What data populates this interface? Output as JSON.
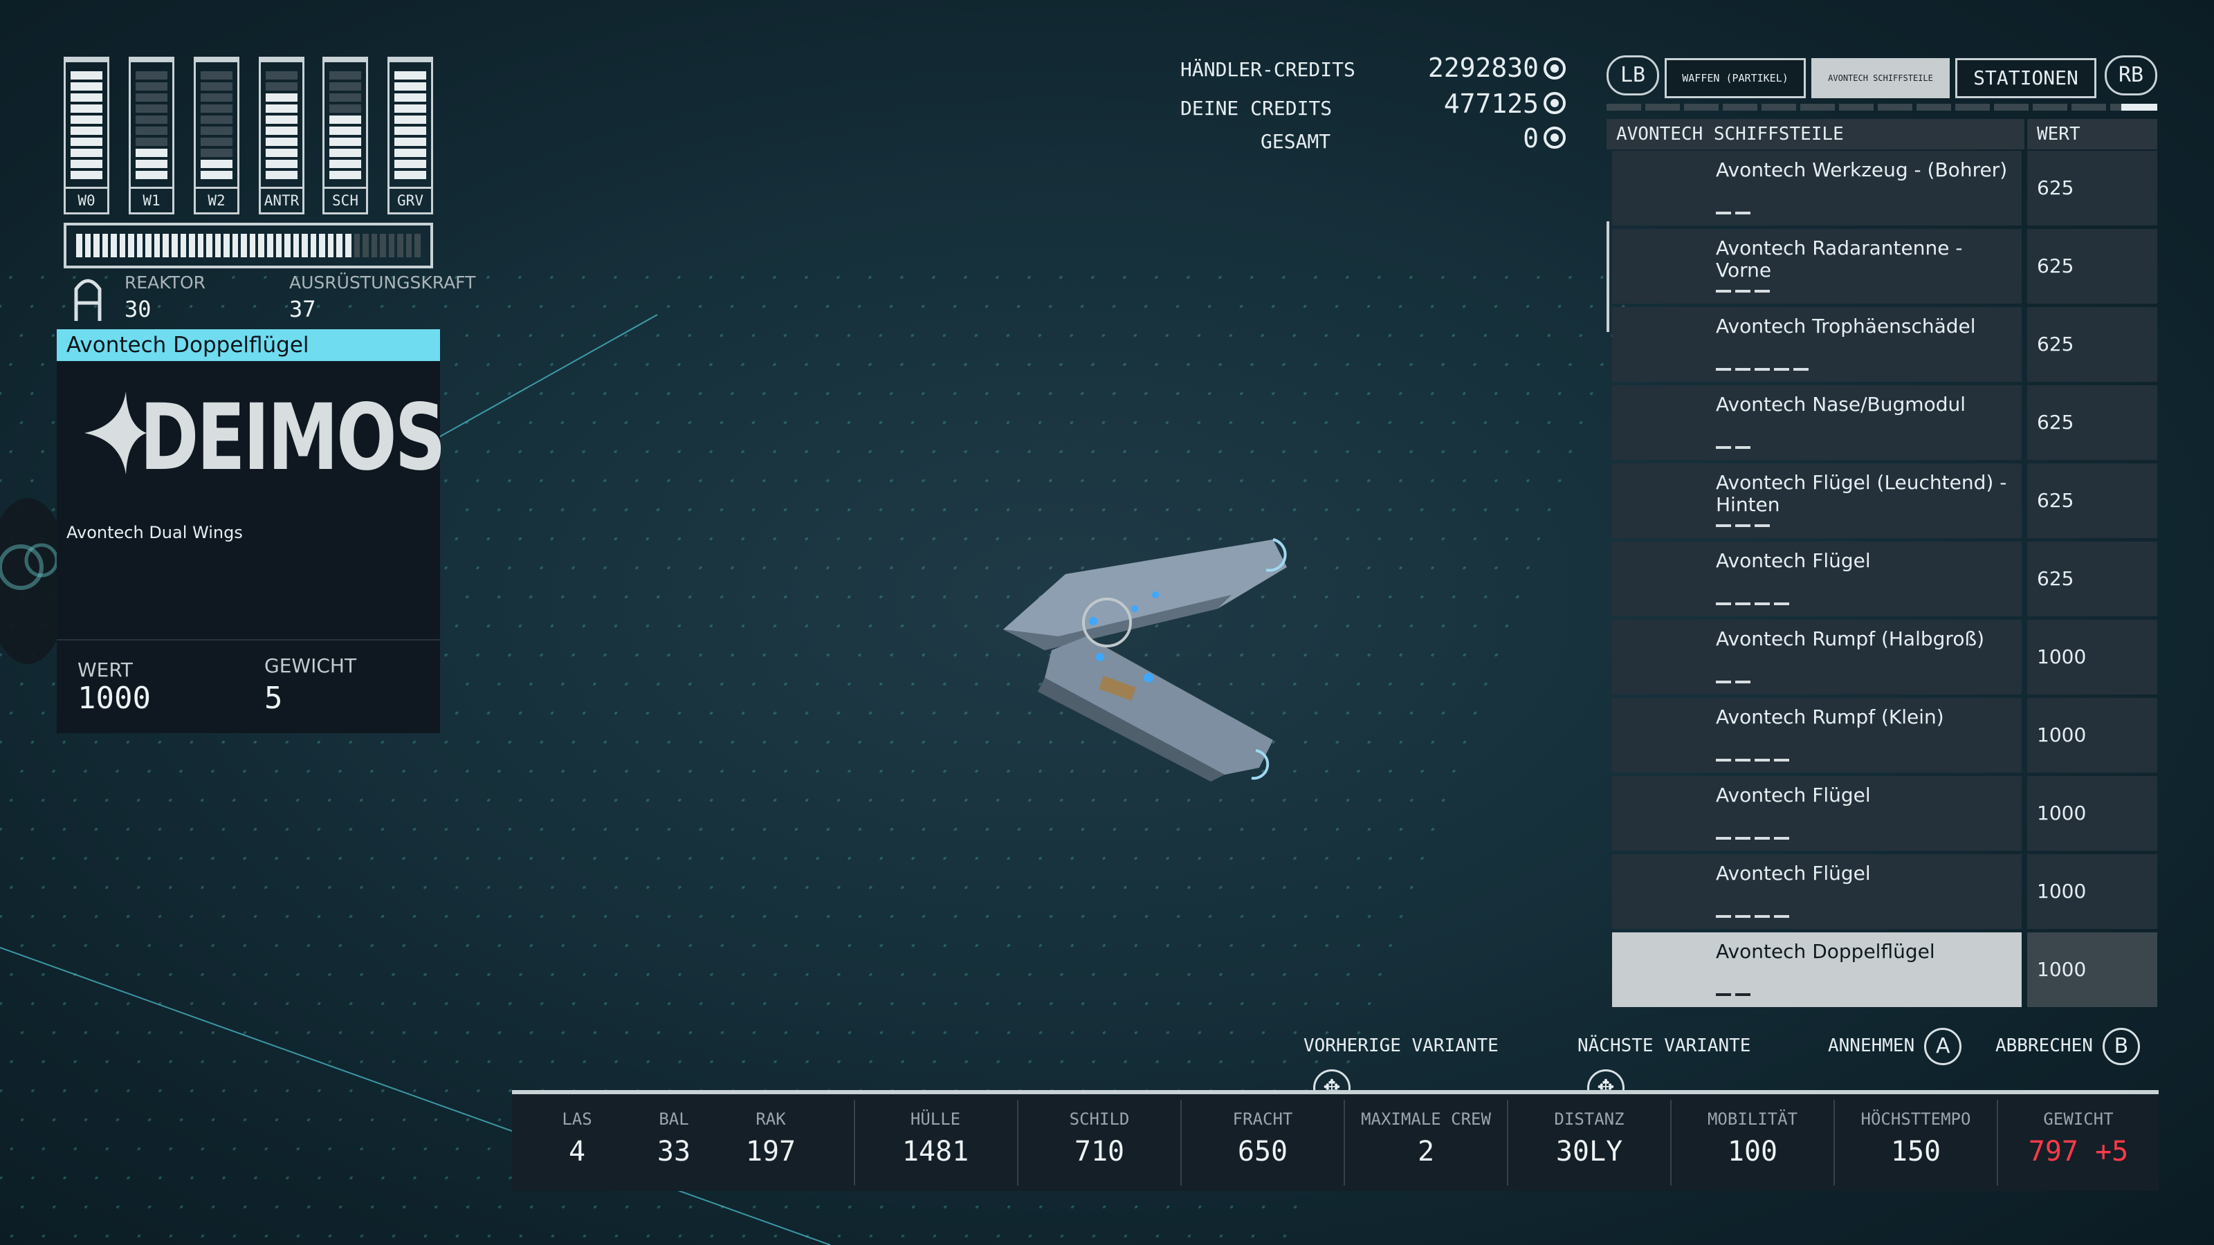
{
  "power": {
    "columns": [
      {
        "label": "W0",
        "level": 1.0
      },
      {
        "label": "W1",
        "level": 0.3
      },
      {
        "label": "W2",
        "level": 0.2
      },
      {
        "label": "ANTR",
        "level": 0.75
      },
      {
        "label": "SCH",
        "level": 0.6
      },
      {
        "label": "GRV",
        "level": 1.0
      }
    ],
    "reactor_fill": 0.8,
    "reactor_label": "REAKTOR",
    "reactor_value": "30",
    "equip_label": "AUSRÜSTUNGSKRAFT",
    "equip_value": "37"
  },
  "item": {
    "title": "Avontech Doppelflügel",
    "brand": "DEIMOS",
    "subtitle": "Avontech Dual Wings",
    "value_label": "WERT",
    "value": "1000",
    "weight_label": "GEWICHT",
    "weight": "5"
  },
  "credits": {
    "vendor_label": "HÄNDLER-CREDITS",
    "vendor_value": "2292830",
    "yours_label": "DEINE CREDITS",
    "yours_value": "477125",
    "total_label": "GESAMT",
    "total_value": "0"
  },
  "tabs": {
    "lb": "LB",
    "weapons": "WAFFEN (PARTIKEL)",
    "avontech": "AVONTECH SCHIFFSTEILE",
    "stations": "STATIONEN",
    "rb": "RB"
  },
  "list": {
    "col_name": "AVONTECH SCHIFFSTEILE",
    "col_value": "WERT",
    "rows": [
      {
        "name": "Avontech Werkzeug - (Bohrer)",
        "value": "625",
        "dashes": 2
      },
      {
        "name": "Avontech Radarantenne - Vorne",
        "value": "625",
        "dashes": 3
      },
      {
        "name": "Avontech Trophäenschädel",
        "value": "625",
        "dashes": 5
      },
      {
        "name": "Avontech Nase/Bugmodul",
        "value": "625",
        "dashes": 2
      },
      {
        "name": "Avontech Flügel (Leuchtend) - Hinten",
        "value": "625",
        "dashes": 3
      },
      {
        "name": "Avontech Flügel",
        "value": "625",
        "dashes": 4
      },
      {
        "name": "Avontech Rumpf (Halbgroß)",
        "value": "1000",
        "dashes": 2
      },
      {
        "name": "Avontech Rumpf (Klein)",
        "value": "1000",
        "dashes": 4
      },
      {
        "name": "Avontech Flügel",
        "value": "1000",
        "dashes": 4
      },
      {
        "name": "Avontech Flügel",
        "value": "1000",
        "dashes": 4
      },
      {
        "name": "Avontech Doppelflügel",
        "value": "1000",
        "dashes": 2,
        "selected": true
      }
    ]
  },
  "actions": {
    "prev": "VORHERIGE VARIANTE",
    "next": "NÄCHSTE VARIANTE",
    "accept": "ANNEHMEN",
    "accept_key": "A",
    "cancel": "ABBRECHEN",
    "cancel_key": "B"
  },
  "stats": {
    "las": {
      "label": "LAS",
      "value": "4"
    },
    "bal": {
      "label": "BAL",
      "value": "33"
    },
    "rak": {
      "label": "RAK",
      "value": "197"
    },
    "hull": {
      "label": "HÜLLE",
      "value": "1481"
    },
    "shield": {
      "label": "SCHILD",
      "value": "710"
    },
    "cargo": {
      "label": "FRACHT",
      "value": "650"
    },
    "crew": {
      "label": "MAXIMALE CREW",
      "value": "2"
    },
    "jump": {
      "label": "DISTANZ",
      "value": "30LY"
    },
    "mobility": {
      "label": "MOBILITÄT",
      "value": "100"
    },
    "topspeed": {
      "label": "HÖCHSTTEMPO",
      "value": "150"
    },
    "mass": {
      "label": "GEWICHT",
      "value": "797",
      "delta": "+5"
    }
  },
  "colors": {
    "accent": "#6fdcf0",
    "warning": "#ff3a4a",
    "selected_row": "#c8cdd0"
  }
}
